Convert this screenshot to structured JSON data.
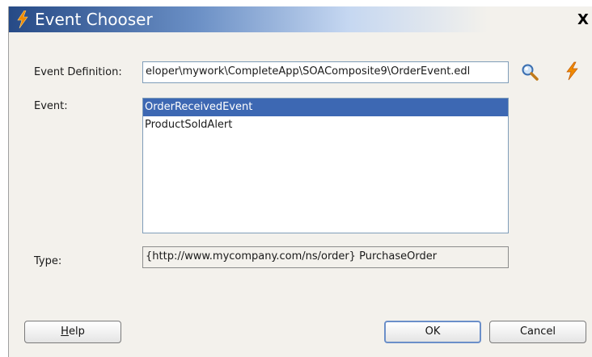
{
  "dialog": {
    "title": "Event Chooser",
    "close_label": "X"
  },
  "form": {
    "event_definition_label": "Event Definition:",
    "event_definition_value": "eloper\\mywork\\CompleteApp\\SOAComposite9\\OrderEvent.edl",
    "event_label": "Event:",
    "events": [
      {
        "label": "OrderReceivedEvent",
        "selected": true
      },
      {
        "label": "ProductSoldAlert",
        "selected": false
      }
    ],
    "type_label": "Type:",
    "type_value": "{http://www.mycompany.com/ns/order} PurchaseOrder"
  },
  "buttons": {
    "help_label": "Help",
    "help_mnemonic": "H",
    "help_rest": "elp",
    "ok_label": "OK",
    "cancel_label": "Cancel"
  },
  "icons": {
    "title": "lightning-icon",
    "browse": "search-icon",
    "create_event": "lightning-icon"
  },
  "colors": {
    "title_gradient_start": "#264a86",
    "selection": "#3d68b3",
    "lightning": "#f08a00"
  }
}
